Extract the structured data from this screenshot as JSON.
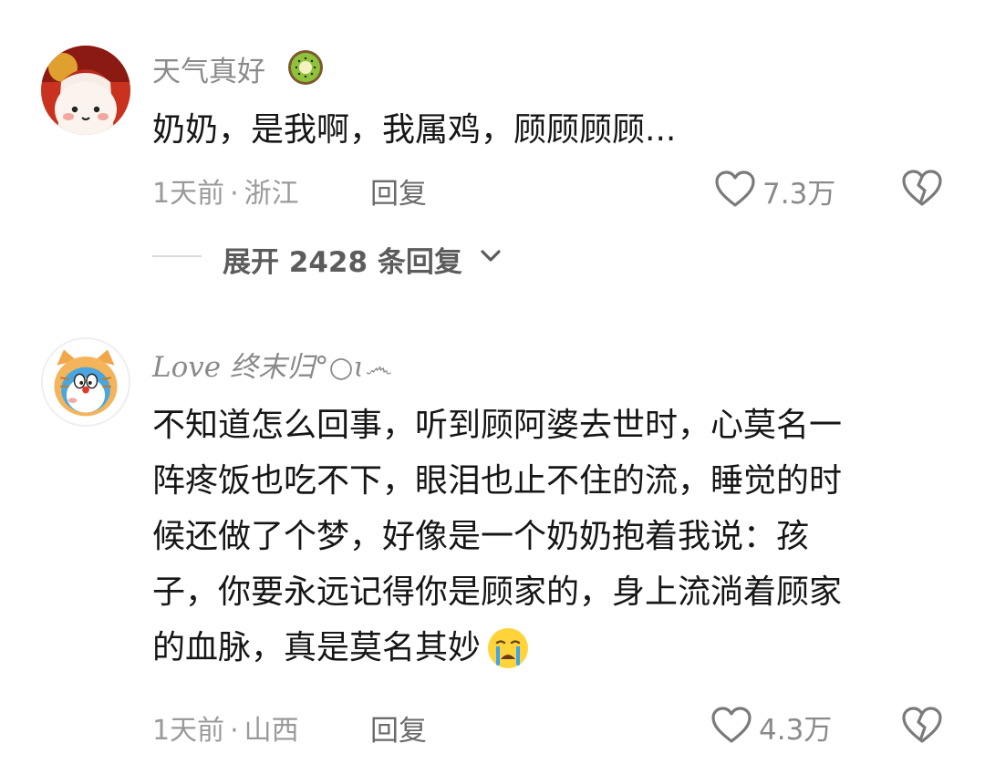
{
  "comments": [
    {
      "username": "天气真好",
      "username_emoji": "kiwi-emoji",
      "text": "奶奶，是我啊，我属鸡，顾顾顾顾...",
      "time": "1天前",
      "location_sep": "·",
      "location": "浙江",
      "reply_label": "回复",
      "like_count": "7.3万",
      "expand_label": "展开 2428 条回复"
    },
    {
      "username": "Love 终末归°○ɩ෴",
      "text_lines": [
        "不知道怎么回事，听到顾阿婆去世时，心莫名一",
        "阵疼饭也吃不下，眼泪也止不住的流，睡觉的时",
        "候还做了个梦，好像是一个奶奶抱着我说：孩",
        "子，你要永远记得你是顾家的，身上流淌着顾家",
        "的血脉，真是莫名其妙"
      ],
      "text_emoji": "crying-face-emoji",
      "time": "1天前",
      "location_sep": "·",
      "location": "山西",
      "reply_label": "回复",
      "like_count": "4.3万"
    }
  ],
  "colors": {
    "text": "#161616",
    "username": "#8a8a8a",
    "meta": "#9a9a9a",
    "icon": "#7a7a7a"
  }
}
